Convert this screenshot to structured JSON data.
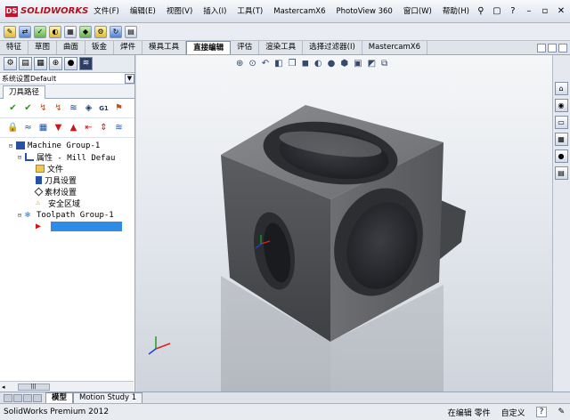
{
  "app": {
    "logo_text": "SOLIDWORKS",
    "menu": [
      "文件(F)",
      "编辑(E)",
      "视图(V)",
      "插入(I)",
      "工具(T)",
      "MastercamX6",
      "PhotoView 360",
      "窗口(W)",
      "帮助(H)"
    ]
  },
  "tabs": [
    {
      "label": "特征",
      "active": false
    },
    {
      "label": "草图",
      "active": false
    },
    {
      "label": "曲面",
      "active": false
    },
    {
      "label": "钣金",
      "active": false
    },
    {
      "label": "焊件",
      "active": false
    },
    {
      "label": "模具工具",
      "active": false
    },
    {
      "label": "直接编辑",
      "active": true
    },
    {
      "label": "评估",
      "active": false
    },
    {
      "label": "渲染工具",
      "active": false
    },
    {
      "label": "选择过滤器(I)",
      "active": false
    },
    {
      "label": "MastercamX6",
      "active": false
    }
  ],
  "panel": {
    "machine_combo": "系统设置Default",
    "tab_label": "刀具路径",
    "tree": {
      "machine_group": "Machine Group-1",
      "properties": "属性 - Mill Defau",
      "files": "文件",
      "tool_settings": "刀具设置",
      "stock_settings": "素材设置",
      "safety_zone": "安全区域",
      "toolpath_group": "Toolpath Group-1"
    },
    "scroll_thumb": "|||"
  },
  "model_tabs": [
    "模型",
    "Motion Study 1"
  ],
  "status": {
    "left": "SolidWorks Premium 2012",
    "mode": "在编辑 零件",
    "custom": "自定义",
    "help": "?"
  },
  "colors": {
    "selection": "#2e8be6",
    "part_body": "#4e4f53",
    "accent_red": "#c8102e"
  }
}
